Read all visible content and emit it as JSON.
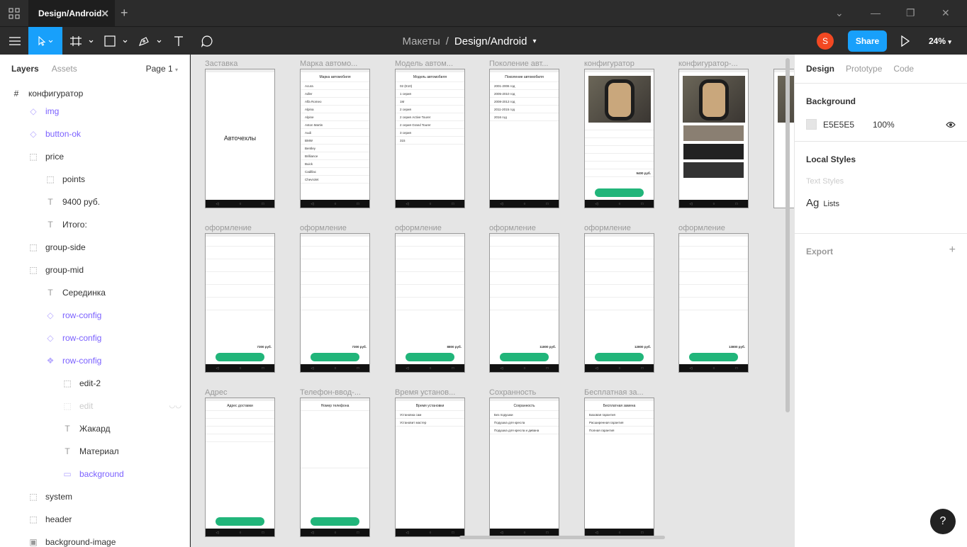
{
  "titlebar": {
    "tab_title": "Design/Android"
  },
  "toolbar": {
    "breadcrumb_project": "Макеты",
    "breadcrumb_sep": "/",
    "breadcrumb_file": "Design/Android",
    "avatar_letter": "S",
    "share_label": "Share",
    "zoom": "24%"
  },
  "left_panel": {
    "tab_layers": "Layers",
    "tab_assets": "Assets",
    "page": "Page 1",
    "frame_name": "конфигуратор",
    "layers": [
      {
        "label": "img",
        "icon": "component-instance-icon"
      },
      {
        "label": "button-ok",
        "icon": "component-instance-icon"
      },
      {
        "label": "price",
        "icon": "group-icon"
      },
      {
        "label": "points",
        "icon": "group-icon"
      },
      {
        "label": "9400 руб.",
        "icon": "text-icon"
      },
      {
        "label": "Итого:",
        "icon": "text-icon"
      },
      {
        "label": "group-side",
        "icon": "group-icon"
      },
      {
        "label": "group-mid",
        "icon": "group-icon"
      },
      {
        "label": "Серединка",
        "icon": "text-icon"
      },
      {
        "label": "row-config",
        "icon": "component-instance-icon"
      },
      {
        "label": "row-config",
        "icon": "component-instance-icon"
      },
      {
        "label": "row-config",
        "icon": "component-main-icon"
      },
      {
        "label": "edit-2",
        "icon": "group-icon"
      },
      {
        "label": "edit",
        "icon": "group-icon"
      },
      {
        "label": "Жакард",
        "icon": "text-icon"
      },
      {
        "label": "Материал",
        "icon": "text-icon"
      },
      {
        "label": "background",
        "icon": "rectangle-icon"
      },
      {
        "label": "system",
        "icon": "group-icon"
      },
      {
        "label": "header",
        "icon": "group-icon"
      },
      {
        "label": "background-image",
        "icon": "image-icon"
      }
    ]
  },
  "canvas": {
    "frames": [
      {
        "label": "Заставка",
        "kind": "splash",
        "text": "Авточехлы"
      },
      {
        "label": "Марка автомо...",
        "kind": "list",
        "title": "Марка автомобиля",
        "rows": [
          "Acura",
          "Adler",
          "Alfa Romeo",
          "Alpina",
          "Alpine",
          "Aston Martin",
          "Audi",
          "BMW",
          "Bentley",
          "Brilliance",
          "Buick",
          "Cadillac",
          "Chevrolet"
        ]
      },
      {
        "label": "Модель автом...",
        "kind": "list",
        "title": "Модель автомобиля",
        "rows": [
          "02 (E10)",
          "1 серия",
          "1M",
          "2 серия",
          "2 серия Active Tourer",
          "2 серия Grand Tourer",
          "3 серия",
          "315"
        ]
      },
      {
        "label": "Поколение авт...",
        "kind": "list",
        "title": "Поколение автомобиля",
        "rows": [
          "2001-2006 год",
          "2005-2010 год",
          "2008-2013 год",
          "2011-2015 год",
          "2016 год"
        ]
      },
      {
        "label": "конфигуратор",
        "kind": "config",
        "price": "9400 руб."
      },
      {
        "label": "конфигуратор-...",
        "kind": "material"
      },
      {
        "label": "оформление",
        "kind": "checkout",
        "total": "7300 руб."
      },
      {
        "label": "оформление",
        "kind": "checkout",
        "total": "7300 руб."
      },
      {
        "label": "оформление",
        "kind": "checkout",
        "total": "8800 руб."
      },
      {
        "label": "оформление",
        "kind": "checkout",
        "total": "11800 руб."
      },
      {
        "label": "оформление",
        "kind": "checkout",
        "total": "12800 руб."
      },
      {
        "label": "оформление",
        "kind": "checkout",
        "total": "13800 руб."
      },
      {
        "label": "Адрес",
        "kind": "form",
        "title": "Адрес доставки"
      },
      {
        "label": "Телефон-ввод-...",
        "kind": "phone",
        "title": "Номер телефона"
      },
      {
        "label": "Время установ...",
        "kind": "list",
        "title": "Время установки",
        "rows": [
          "Установка сам",
          "Установит мастер"
        ]
      },
      {
        "label": "Сохранность",
        "kind": "list",
        "title": "Сохранность",
        "rows": [
          "Без подушки",
          "Подушка для кресла",
          "Подушка для кресла и дивана"
        ]
      },
      {
        "label": "Бесплатная за...",
        "kind": "list",
        "title": "Бесплатная замена",
        "rows": [
          "Базовая гарантия",
          "Расширенная гарантия",
          "Полная гарантия"
        ]
      }
    ]
  },
  "right_panel": {
    "tab_design": "Design",
    "tab_prototype": "Prototype",
    "tab_code": "Code",
    "background_title": "Background",
    "bg_hex": "E5E5E5",
    "bg_opacity": "100%",
    "bg_color": "#E5E5E5",
    "local_styles_title": "Local Styles",
    "text_styles_label": "Text Styles",
    "style_sample": "Ag",
    "style_name": "Lists",
    "export_title": "Export"
  },
  "help_label": "?"
}
